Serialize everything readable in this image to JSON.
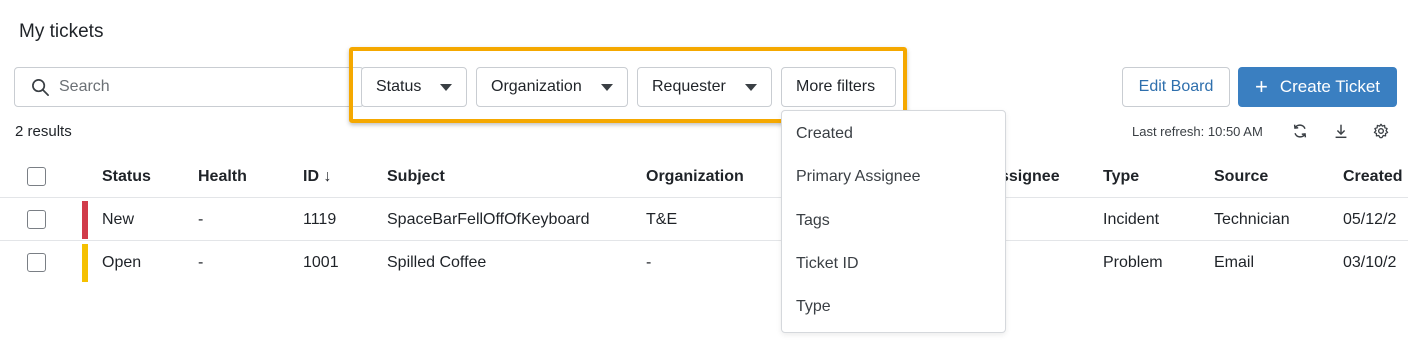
{
  "page": {
    "title": "My tickets"
  },
  "search": {
    "placeholder": "Search"
  },
  "filters": {
    "status": "Status",
    "organization": "Organization",
    "requester": "Requester",
    "more": "More filters"
  },
  "actions": {
    "edit_board": "Edit Board",
    "create_ticket": "Create Ticket"
  },
  "summary": {
    "results": "2 results",
    "last_refresh": "Last refresh: 10:50 AM"
  },
  "table": {
    "headers": {
      "status": "Status",
      "health": "Health",
      "id": "ID ↓",
      "subject": "Subject",
      "organization": "Organization",
      "assignee": "ssignee",
      "type": "Type",
      "source": "Source",
      "created": "Created"
    },
    "rows": [
      {
        "status": "New",
        "status_color": "#d13b4a",
        "health": "-",
        "id": "1119",
        "subject": "SpaceBarFellOffOfKeyboard",
        "organization": "T&E",
        "type": "Incident",
        "source": "Technician",
        "created": "05/12/2"
      },
      {
        "status": "Open",
        "status_color": "#f5c000",
        "health": "-",
        "id": "1001",
        "subject": "Spilled Coffee",
        "organization": "-",
        "type": "Problem",
        "source": "Email",
        "created": "03/10/2"
      }
    ]
  },
  "more_filters_menu": [
    "Created",
    "Primary Assignee",
    "Tags",
    "Ticket ID",
    "Type"
  ],
  "colors": {
    "highlight": "#f5a800",
    "primary": "#3a7fc1",
    "link": "#2e6fad"
  },
  "icons": [
    "search-icon",
    "caret-down-icon",
    "plus-icon",
    "refresh-icon",
    "download-icon",
    "settings-icon"
  ]
}
